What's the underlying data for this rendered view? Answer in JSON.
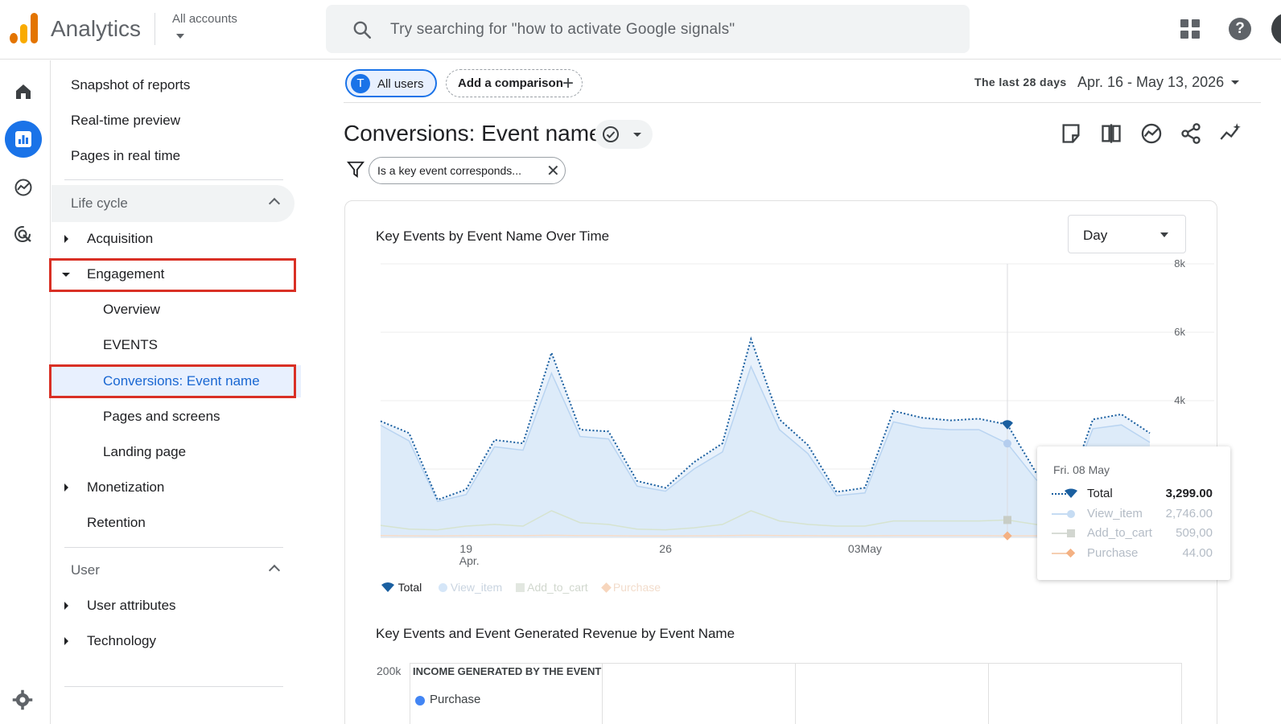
{
  "topbar": {
    "app_name": "Analytics",
    "accounts_label": "All accounts",
    "search_placeholder": "Try searching for \"how to activate Google signals\"",
    "help_glyph": "?"
  },
  "rail": {
    "items": [
      "home-icon",
      "reports-icon",
      "explore-icon",
      "advertising-icon"
    ],
    "active": "reports-icon"
  },
  "nav": {
    "top_links": [
      "Snapshot of reports",
      "Real-time preview",
      "Pages in real time"
    ],
    "lifecycle": {
      "heading": "Life cycle",
      "acquisition": "Acquisition",
      "engagement": "Engagement",
      "engagement_children": [
        "Overview",
        "EVENTS",
        "Conversions: Event name",
        "Pages and screens",
        "Landing page"
      ],
      "monetization": "Monetization",
      "retention": "Retention"
    },
    "user": {
      "heading": "User",
      "user_attributes": "User attributes",
      "technology": "Technology"
    }
  },
  "main": {
    "segment_chip": {
      "avatar": "T",
      "label": "All users"
    },
    "comparison_chip": "Add a comparison",
    "date_label": "The last 28 days",
    "date_range": "Apr. 16 - May 13, 2026",
    "page_title": "Conversions: Event name",
    "filter_chip": "Is a key event corresponds...",
    "filter_close": "✕",
    "card": {
      "title": "Key Events by Event Name Over Time",
      "granularity": "Day",
      "legend": [
        "Total",
        "View_item",
        "Add_to_cart",
        "Purchase"
      ],
      "tooltip": {
        "date": "Fri. 08 May",
        "rows": [
          {
            "name": "Total",
            "value": "3,299.00"
          },
          {
            "name": "View_item",
            "value": "2,746.00"
          },
          {
            "name": "Add_to_cart",
            "value": "509,00"
          },
          {
            "name": "Purchase",
            "value": "44.00"
          }
        ]
      },
      "section2_title": "Key Events and Event Generated Revenue by Event Name",
      "section2_axis": "200k",
      "section2_header": "INCOME GENERATED BY THE EVENT",
      "section2_legend": "Purchase"
    }
  },
  "colors": {
    "accent": "#1a73e8",
    "total_line": "#1a5fa0",
    "view_item_fill": "#d5e6f8",
    "add_to_cart": "#b7d3b0",
    "purchase": "#f4b183",
    "highlight_border": "#d93025"
  },
  "chart_data": {
    "type": "line",
    "title": "Key Events by Event Name Over Time",
    "x_tick_labels": [
      "19\nApr.",
      "26",
      "03May"
    ],
    "y_tick_labels": [
      "4k",
      "6k",
      "8k"
    ],
    "ylim": [
      0,
      8000
    ],
    "x_dates": [
      "Apr 16",
      "Apr 17",
      "Apr 18",
      "Apr 19",
      "Apr 20",
      "Apr 21",
      "Apr 22",
      "Apr 23",
      "Apr 24",
      "Apr 25",
      "Apr 26",
      "Apr 27",
      "Apr 28",
      "Apr 29",
      "Apr 30",
      "May 1",
      "May 2",
      "May 3",
      "May 4",
      "May 5",
      "May 6",
      "May 7",
      "May 8",
      "May 9",
      "May 10",
      "May 11",
      "May 12",
      "May 13"
    ],
    "series": [
      {
        "name": "Total",
        "values": [
          3400,
          3050,
          1100,
          1400,
          2850,
          2750,
          5400,
          3150,
          3100,
          1650,
          1450,
          2200,
          2750,
          5800,
          3450,
          2700,
          1330,
          1450,
          3700,
          3500,
          3420,
          3470,
          3299,
          1900,
          1100,
          3450,
          3600,
          3050
        ]
      },
      {
        "name": "View_item",
        "values": [
          3280,
          2820,
          1050,
          1250,
          2650,
          2550,
          4800,
          2950,
          2880,
          1500,
          1350,
          2000,
          2500,
          5000,
          3150,
          2450,
          1220,
          1300,
          3380,
          3200,
          3150,
          3150,
          2746,
          1700,
          1050,
          3180,
          3290,
          2780
        ]
      },
      {
        "name": "Add_to_cart",
        "values": [
          350,
          240,
          220,
          330,
          380,
          330,
          780,
          430,
          380,
          240,
          220,
          280,
          380,
          780,
          480,
          380,
          330,
          330,
          480,
          480,
          480,
          480,
          509,
          380,
          280,
          430,
          480,
          430
        ]
      },
      {
        "name": "Purchase",
        "values": [
          55,
          44,
          40,
          50,
          55,
          50,
          60,
          50,
          50,
          40,
          40,
          44,
          50,
          60,
          55,
          50,
          44,
          44,
          50,
          50,
          50,
          50,
          44,
          44,
          40,
          50,
          50,
          50
        ]
      }
    ],
    "hover_date": "May 8",
    "grid": "horizontal",
    "legend": "bottom-left"
  }
}
